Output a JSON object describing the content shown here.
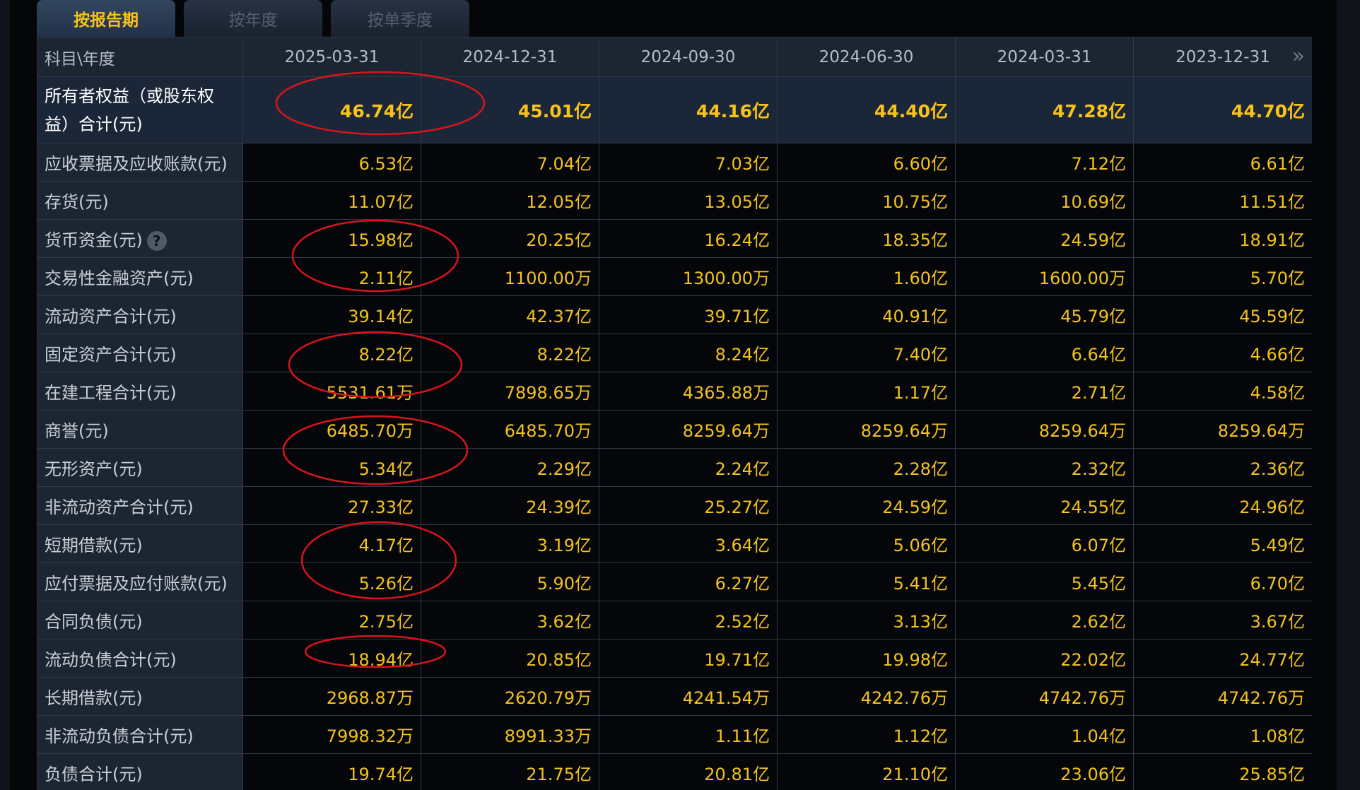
{
  "tabs": [
    {
      "label": "按报告期",
      "active": true
    },
    {
      "label": "按年度",
      "active": false
    },
    {
      "label": "按单季度",
      "active": false
    }
  ],
  "table": {
    "corner_label": "科目\\年度",
    "columns": [
      "2025-03-31",
      "2024-12-31",
      "2024-09-30",
      "2024-06-30",
      "2024-03-31",
      "2023-12-31"
    ],
    "more_icon": "double-chevron-right-icon",
    "rows": [
      {
        "label": "所有者权益（或股东权益）合计(元)",
        "values": [
          "46.74亿",
          "45.01亿",
          "44.16亿",
          "44.40亿",
          "47.28亿",
          "44.70亿"
        ]
      },
      {
        "label": "应收票据及应收账款(元)",
        "values": [
          "6.53亿",
          "7.04亿",
          "7.03亿",
          "6.60亿",
          "7.12亿",
          "6.61亿"
        ]
      },
      {
        "label": "存货(元)",
        "values": [
          "11.07亿",
          "12.05亿",
          "13.05亿",
          "10.75亿",
          "10.69亿",
          "11.51亿"
        ]
      },
      {
        "label": "货币资金(元)",
        "values": [
          "15.98亿",
          "20.25亿",
          "16.24亿",
          "18.35亿",
          "24.59亿",
          "18.91亿"
        ]
      },
      {
        "label": "交易性金融资产(元)",
        "values": [
          "2.11亿",
          "1100.00万",
          "1300.00万",
          "1.60亿",
          "1600.00万",
          "5.70亿"
        ]
      },
      {
        "label": "流动资产合计(元)",
        "values": [
          "39.14亿",
          "42.37亿",
          "39.71亿",
          "40.91亿",
          "45.79亿",
          "45.59亿"
        ]
      },
      {
        "label": "固定资产合计(元)",
        "values": [
          "8.22亿",
          "8.22亿",
          "8.24亿",
          "7.40亿",
          "6.64亿",
          "4.66亿"
        ]
      },
      {
        "label": "在建工程合计(元)",
        "values": [
          "5531.61万",
          "7898.65万",
          "4365.88万",
          "1.17亿",
          "2.71亿",
          "4.58亿"
        ]
      },
      {
        "label": "商誉(元)",
        "values": [
          "6485.70万",
          "6485.70万",
          "8259.64万",
          "8259.64万",
          "8259.64万",
          "8259.64万"
        ]
      },
      {
        "label": "无形资产(元)",
        "values": [
          "5.34亿",
          "2.29亿",
          "2.24亿",
          "2.28亿",
          "2.32亿",
          "2.36亿"
        ]
      },
      {
        "label": "非流动资产合计(元)",
        "values": [
          "27.33亿",
          "24.39亿",
          "25.27亿",
          "24.59亿",
          "24.55亿",
          "24.96亿"
        ]
      },
      {
        "label": "短期借款(元)",
        "values": [
          "4.17亿",
          "3.19亿",
          "3.64亿",
          "5.06亿",
          "6.07亿",
          "5.49亿"
        ]
      },
      {
        "label": "应付票据及应付账款(元)",
        "values": [
          "5.26亿",
          "5.90亿",
          "6.27亿",
          "5.41亿",
          "5.45亿",
          "6.70亿"
        ]
      },
      {
        "label": "合同负债(元)",
        "values": [
          "2.75亿",
          "3.62亿",
          "2.52亿",
          "3.13亿",
          "2.62亿",
          "3.67亿"
        ]
      },
      {
        "label": "流动负债合计(元)",
        "values": [
          "18.94亿",
          "20.85亿",
          "19.71亿",
          "19.98亿",
          "22.02亿",
          "24.77亿"
        ]
      },
      {
        "label": "长期借款(元)",
        "values": [
          "2968.87万",
          "2620.79万",
          "4241.54万",
          "4242.76万",
          "4742.76万",
          "4742.76万"
        ]
      },
      {
        "label": "非流动负债合计(元)",
        "values": [
          "7998.32万",
          "8991.33万",
          "1.11亿",
          "1.12亿",
          "1.04亿",
          "1.08亿"
        ]
      },
      {
        "label": "负债合计(元)",
        "values": [
          "19.74亿",
          "21.75亿",
          "20.81亿",
          "21.10亿",
          "23.06亿",
          "25.85亿"
        ]
      }
    ],
    "help_icon_row": "货币资金(元)",
    "help_icon_name": "question-circle-icon"
  },
  "colors": {
    "value_text": "#f4c21c",
    "header_bg": "#1c2532",
    "active_tab_text": "#f7c31a",
    "annotation_stroke": "#d8141c"
  }
}
